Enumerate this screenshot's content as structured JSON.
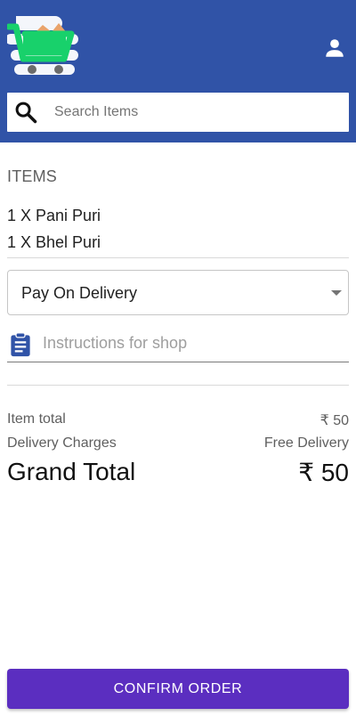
{
  "header": {
    "logo_icon": "shopping-cart-logo",
    "account_icon": "person-icon",
    "background_color": "#3053a7"
  },
  "search": {
    "icon": "search-icon",
    "placeholder": "Search Items",
    "value": ""
  },
  "order": {
    "items_title": "ITEMS",
    "items": [
      {
        "label": "1 X Pani Puri"
      },
      {
        "label": "1 X Bhel Puri"
      }
    ]
  },
  "payment": {
    "selected": "Pay On Delivery"
  },
  "instructions": {
    "icon": "clipboard-icon",
    "placeholder": "Instructions for shop",
    "value": ""
  },
  "summary": {
    "item_total_label": "Item total",
    "item_total_value": "₹ 50",
    "delivery_label": "Delivery Charges",
    "delivery_value": "Free Delivery",
    "grand_total_label": "Grand Total",
    "grand_total_value": "₹ 50"
  },
  "actions": {
    "confirm_label": "CONFIRM ORDER",
    "confirm_color": "#5b2ec0"
  }
}
